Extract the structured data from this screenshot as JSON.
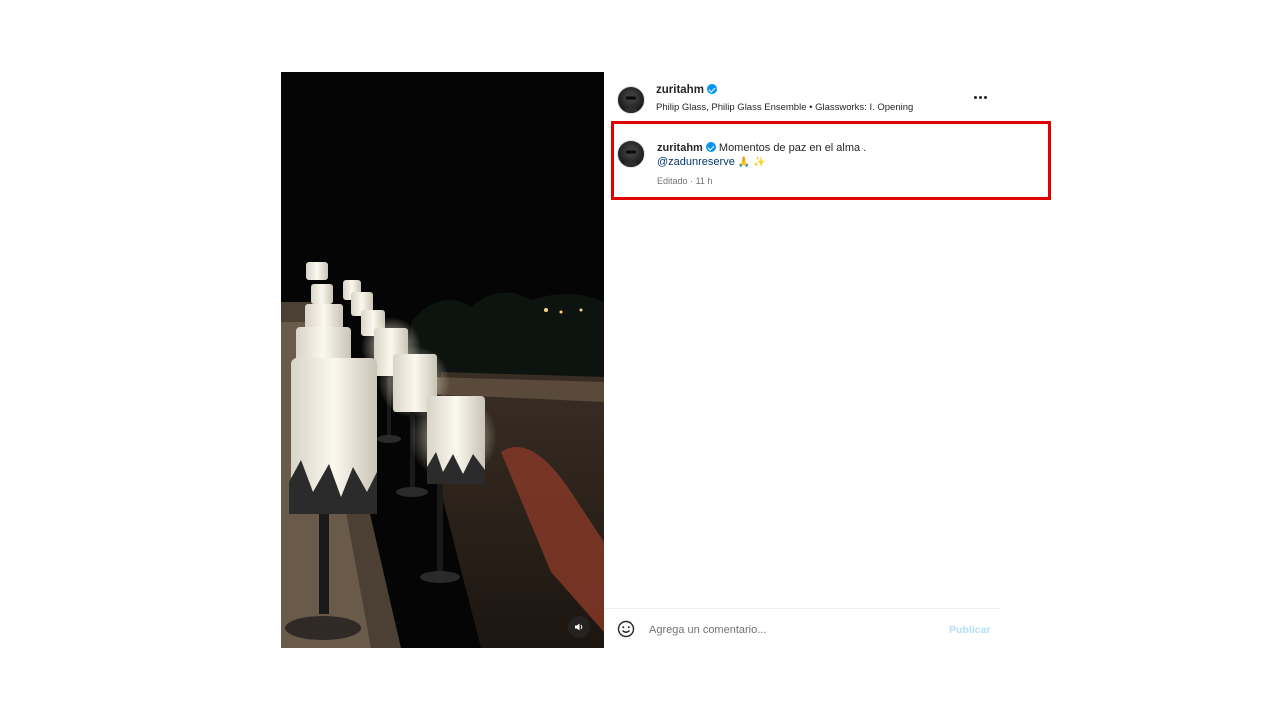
{
  "post": {
    "username": "zuritahm",
    "music": "Philip Glass, Philip Glass Ensemble • Glassworks: I. Opening"
  },
  "caption": {
    "username": "zuritahm",
    "text": "Momentos de paz en el alma .",
    "mention": "@zadunreserve",
    "emojis": "🙏 ✨",
    "edited": "Editado",
    "separator": "·",
    "time": "11 h"
  },
  "comment": {
    "placeholder": "Agrega un comentario...",
    "publish_label": "Publicar"
  },
  "colors": {
    "verified": "#0095f6",
    "highlight": "#e00000",
    "publish_disabled": "#b3dffc"
  },
  "icons": {
    "verified": "verified-badge-icon",
    "more": "more-options-icon",
    "mute": "speaker-icon",
    "emoji": "emoji-smile-icon"
  }
}
